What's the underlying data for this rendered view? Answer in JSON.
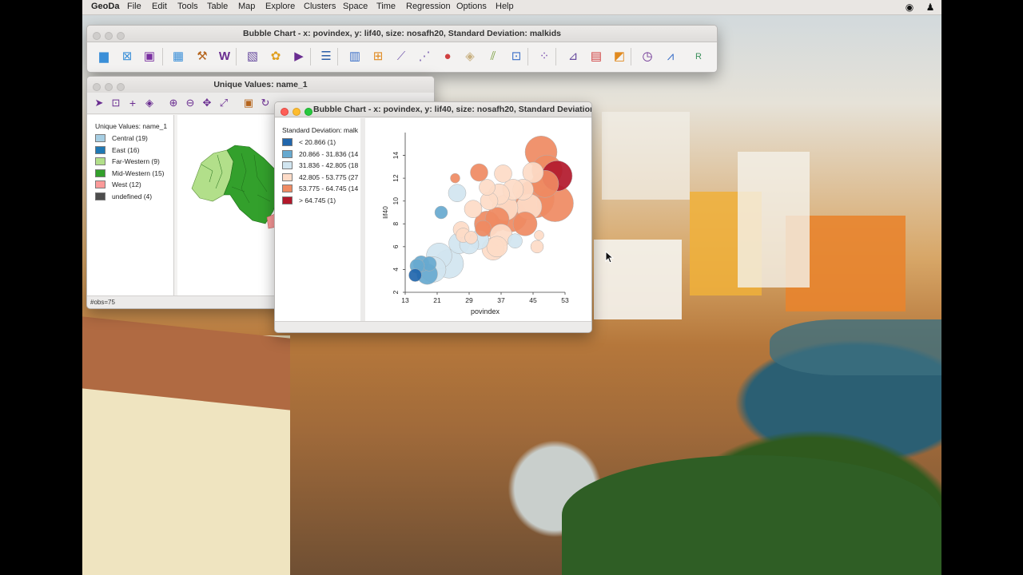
{
  "menubar": {
    "app_name": "GeoDa",
    "items": [
      "File",
      "Edit",
      "Tools",
      "Table",
      "Map",
      "Explore",
      "Clusters",
      "Space",
      "Time",
      "Regression",
      "Options",
      "Help"
    ]
  },
  "main_toolbar_window": {
    "title": "Bubble Chart - x: povindex, y: lif40, size: nosafh20, Standard Deviation: malkids",
    "buttons": [
      "open-project-icon",
      "close-project-icon",
      "save-project-icon",
      "table-icon",
      "tools-hammer-icon",
      "weights-manager-icon",
      "map-icon",
      "cartogram-icon",
      "map-movie-icon",
      "category-editor-icon",
      "histogram-icon",
      "box-plot-icon",
      "scatter-plot-icon",
      "scatter-matrix-icon",
      "bubble-chart-icon",
      "3d-scatter-icon",
      "parallel-coordinate-icon",
      "conditional-plot-icon",
      "cluster-map-icon",
      "moran-scatter-icon",
      "lisa-icon",
      "local-g-icon",
      "time-editor-icon",
      "averages-chart-icon",
      "regression-icon"
    ]
  },
  "unique_values_window": {
    "title": "Unique Values: name_1",
    "legend_title": "Unique Values: name_1",
    "legend": [
      {
        "label": "Central (19)",
        "color": "#a6cee3"
      },
      {
        "label": "East (16)",
        "color": "#1f78b4"
      },
      {
        "label": "Far-Western (9)",
        "color": "#b2df8a"
      },
      {
        "label": "Mid-Western (15)",
        "color": "#33a02c"
      },
      {
        "label": "West (12)",
        "color": "#fb9a99"
      },
      {
        "label": "undefined (4)",
        "color": "#4d4d4d"
      }
    ],
    "status": "#obs=75"
  },
  "bubble_window": {
    "title": "Bubble Chart - x: povindex, y: lif40, size: nosafh20, Standard Deviation...",
    "legend_title": "Standard Deviation: malk",
    "legend": [
      {
        "label": "< 20.866 (1)",
        "color": "#2166ac"
      },
      {
        "label": "20.866 - 31.836 (14",
        "color": "#67a9cf"
      },
      {
        "label": "31.836 - 42.805 (18",
        "color": "#d1e5f0"
      },
      {
        "label": "42.805 - 53.775 (27",
        "color": "#fddbc7"
      },
      {
        "label": "53.775 - 64.745 (14",
        "color": "#ef8a62"
      },
      {
        "label": "> 64.745 (1)",
        "color": "#b2182b"
      }
    ]
  },
  "chart_data": {
    "type": "scatter",
    "title": "",
    "xlabel": "povindex",
    "ylabel": "lif40",
    "xlim": [
      13,
      53
    ],
    "ylim": [
      2,
      16
    ],
    "x_ticks": [
      "13",
      "21",
      "29",
      "37",
      "45",
      "53"
    ],
    "y_ticks": [
      "2",
      "4",
      "6",
      "8",
      "10",
      "12",
      "14"
    ],
    "points": [
      {
        "x": 47.0,
        "y": 14.3,
        "r": 20,
        "c": 4
      },
      {
        "x": 48.5,
        "y": 12.7,
        "r": 19,
        "c": 4
      },
      {
        "x": 51.0,
        "y": 12.2,
        "r": 19,
        "c": 5
      },
      {
        "x": 48.0,
        "y": 11.5,
        "r": 17,
        "c": 4
      },
      {
        "x": 45.5,
        "y": 10.2,
        "r": 24,
        "c": 4
      },
      {
        "x": 50.5,
        "y": 9.8,
        "r": 23,
        "c": 4
      },
      {
        "x": 45.0,
        "y": 12.5,
        "r": 13,
        "c": 3
      },
      {
        "x": 44.0,
        "y": 9.5,
        "r": 16,
        "c": 3
      },
      {
        "x": 42.5,
        "y": 11.0,
        "r": 13,
        "c": 3
      },
      {
        "x": 40.0,
        "y": 11.0,
        "r": 13,
        "c": 3
      },
      {
        "x": 37.5,
        "y": 12.4,
        "r": 11,
        "c": 3
      },
      {
        "x": 36.5,
        "y": 10.6,
        "r": 13,
        "c": 3
      },
      {
        "x": 33.5,
        "y": 11.2,
        "r": 10,
        "c": 3
      },
      {
        "x": 31.5,
        "y": 12.5,
        "r": 11,
        "c": 4
      },
      {
        "x": 25.5,
        "y": 12.0,
        "r": 6,
        "c": 4
      },
      {
        "x": 26.0,
        "y": 10.7,
        "r": 11,
        "c": 2
      },
      {
        "x": 34.0,
        "y": 10.0,
        "r": 11,
        "c": 3
      },
      {
        "x": 30.0,
        "y": 9.3,
        "r": 11,
        "c": 3
      },
      {
        "x": 38.0,
        "y": 9.4,
        "r": 16,
        "c": 3
      },
      {
        "x": 39.5,
        "y": 8.7,
        "r": 20,
        "c": 4
      },
      {
        "x": 36.0,
        "y": 8.4,
        "r": 15,
        "c": 4
      },
      {
        "x": 43.0,
        "y": 8.0,
        "r": 15,
        "c": 4
      },
      {
        "x": 33.5,
        "y": 8.0,
        "r": 16,
        "c": 4
      },
      {
        "x": 32.5,
        "y": 7.6,
        "r": 10,
        "c": 4
      },
      {
        "x": 31.5,
        "y": 6.6,
        "r": 12,
        "c": 2
      },
      {
        "x": 37.0,
        "y": 7.0,
        "r": 14,
        "c": 3
      },
      {
        "x": 36.0,
        "y": 6.0,
        "r": 13,
        "c": 3
      },
      {
        "x": 35.0,
        "y": 5.8,
        "r": 14,
        "c": 3
      },
      {
        "x": 40.5,
        "y": 6.5,
        "r": 9,
        "c": 2
      },
      {
        "x": 46.0,
        "y": 6.0,
        "r": 8,
        "c": 3
      },
      {
        "x": 46.5,
        "y": 7.0,
        "r": 6,
        "c": 3
      },
      {
        "x": 27.0,
        "y": 7.5,
        "r": 10,
        "c": 3
      },
      {
        "x": 27.5,
        "y": 7.0,
        "r": 9,
        "c": 3
      },
      {
        "x": 29.5,
        "y": 6.8,
        "r": 8,
        "c": 3
      },
      {
        "x": 26.5,
        "y": 6.3,
        "r": 13,
        "c": 2
      },
      {
        "x": 29.0,
        "y": 6.2,
        "r": 12,
        "c": 2
      },
      {
        "x": 22.0,
        "y": 9.0,
        "r": 8,
        "c": 1
      },
      {
        "x": 21.5,
        "y": 5.2,
        "r": 16,
        "c": 2
      },
      {
        "x": 17.0,
        "y": 4.5,
        "r": 10,
        "c": 1
      },
      {
        "x": 19.0,
        "y": 4.5,
        "r": 9,
        "c": 1
      },
      {
        "x": 18.5,
        "y": 3.6,
        "r": 13,
        "c": 1
      },
      {
        "x": 16.0,
        "y": 4.3,
        "r": 9,
        "c": 1
      },
      {
        "x": 15.5,
        "y": 3.5,
        "r": 8,
        "c": 0
      },
      {
        "x": 24.0,
        "y": 4.5,
        "r": 18,
        "c": 2
      },
      {
        "x": 20.0,
        "y": 4.0,
        "r": 16,
        "c": 2
      }
    ],
    "palette": [
      "#2166ac",
      "#67a9cf",
      "#d1e5f0",
      "#fddbc7",
      "#ef8a62",
      "#b2182b"
    ]
  }
}
